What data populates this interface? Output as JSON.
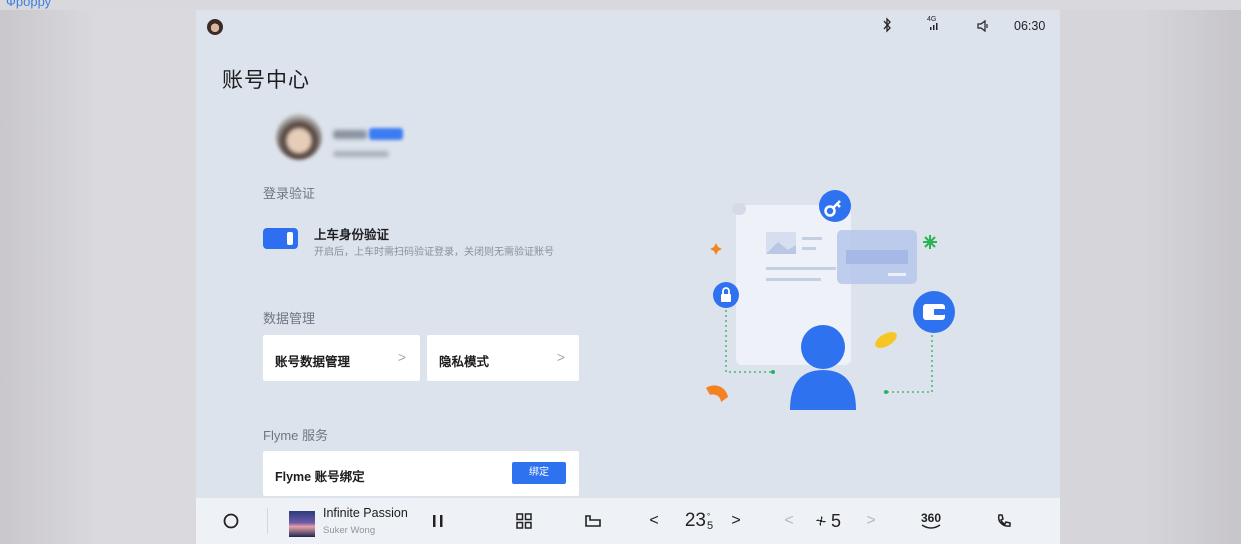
{
  "caption": "Фрорру",
  "status_bar": {
    "signal_label": "4G",
    "time": "06:30"
  },
  "page": {
    "title": "账号中心"
  },
  "login_section": {
    "label": "登录验证",
    "toggle_title": "上车身份验证",
    "toggle_desc": "开启后，上车时需扫码验证登录，关闭则无需验证账号",
    "toggle_on": true
  },
  "data_section": {
    "label": "数据管理",
    "cards": [
      {
        "label": "账号数据管理",
        "chevron": ">"
      },
      {
        "label": "隐私模式",
        "chevron": ">"
      }
    ]
  },
  "flyme_section": {
    "label": "Flyme 服务",
    "bind_label": "Flyme 账号绑定",
    "bind_button": "绑定"
  },
  "dock": {
    "song_title": "Infinite Passion",
    "artist": "Suker Wong",
    "play_state_icon": "pause-icon",
    "temp_main": "23",
    "temp_decimal": "5",
    "temp_degree": "°",
    "fan_level": "5",
    "view_label": "360",
    "prev": "<",
    "next": ">"
  },
  "colors": {
    "accent": "#2f72ef",
    "screen_bg": "#dde3ec"
  }
}
